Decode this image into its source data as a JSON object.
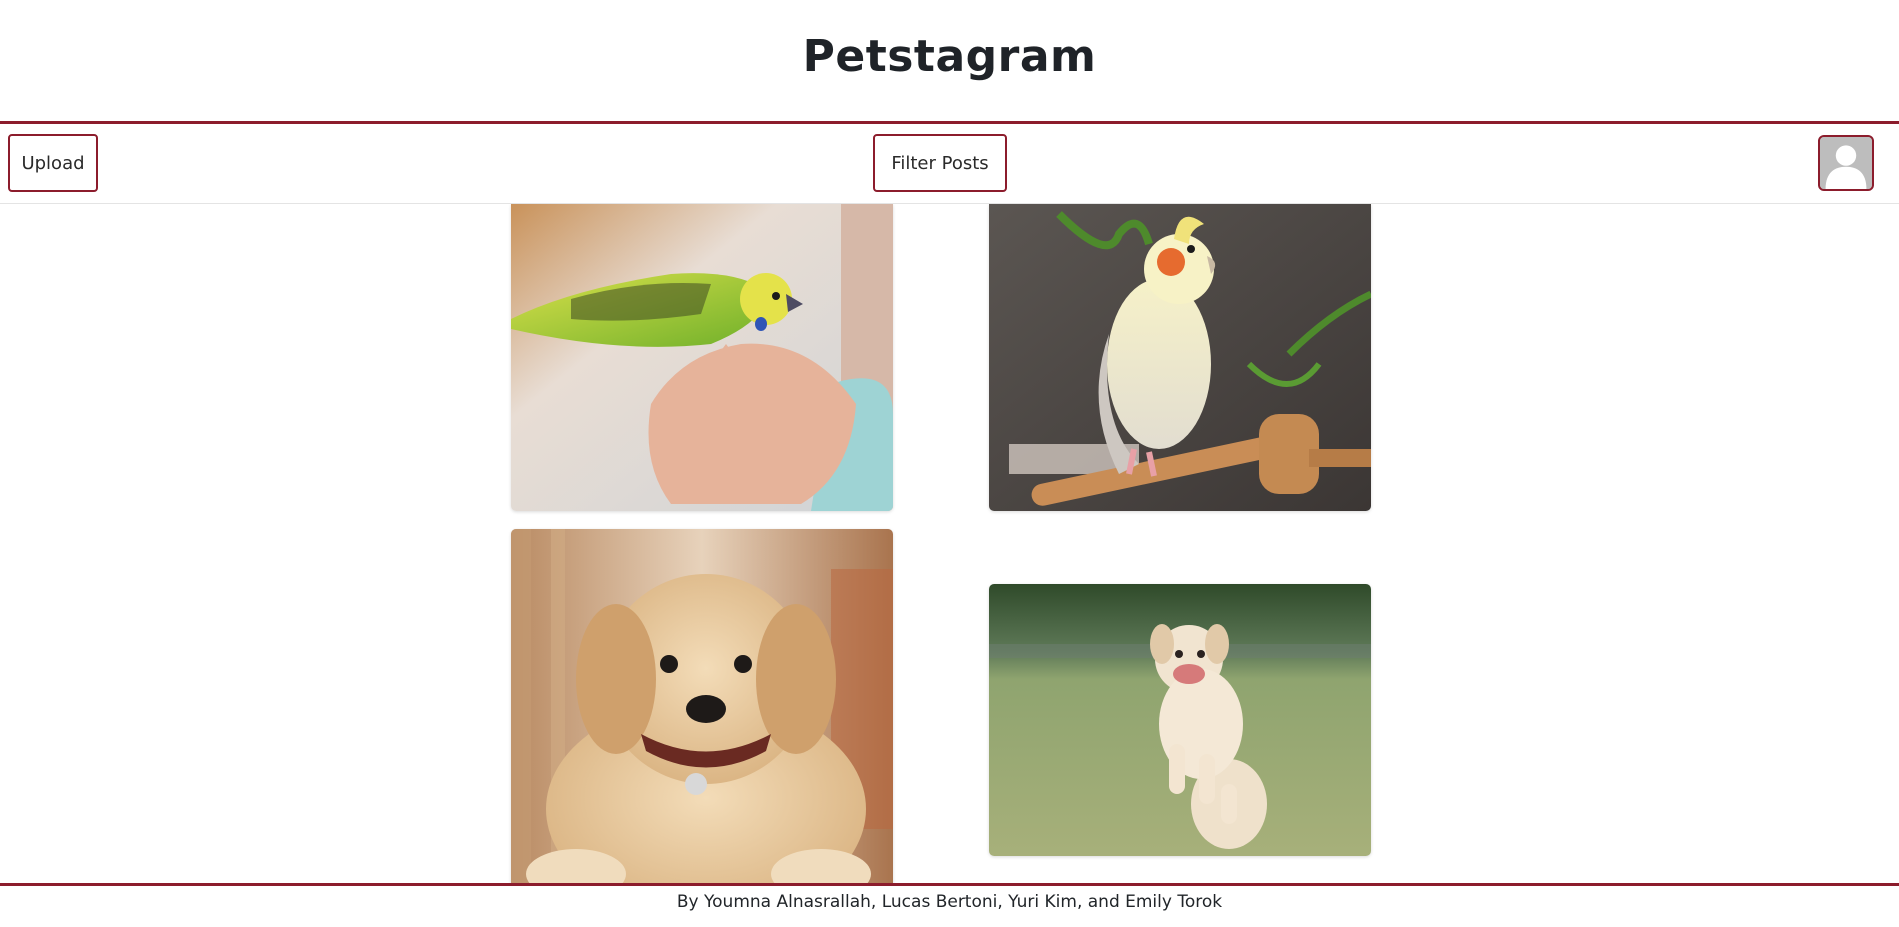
{
  "header": {
    "title": "Petstagram"
  },
  "toolbar": {
    "upload_label": "Upload",
    "filter_label": "Filter Posts",
    "profile_icon": "user-avatar-icon"
  },
  "feed": {
    "posts": [
      {
        "subject": "budgie-on-hand-photo"
      },
      {
        "subject": "cockatiel-on-perch-photo"
      },
      {
        "subject": "golden-retriever-puppy-photo"
      },
      {
        "subject": "labrador-puppy-running-photo"
      }
    ]
  },
  "footer": {
    "credits": "By Youmna Alnasrallah, Lucas Bertoni, Yuri Kim, and Emily Torok"
  },
  "colors": {
    "accent": "#8c1c2c",
    "text": "#212529",
    "background": "#ffffff"
  }
}
